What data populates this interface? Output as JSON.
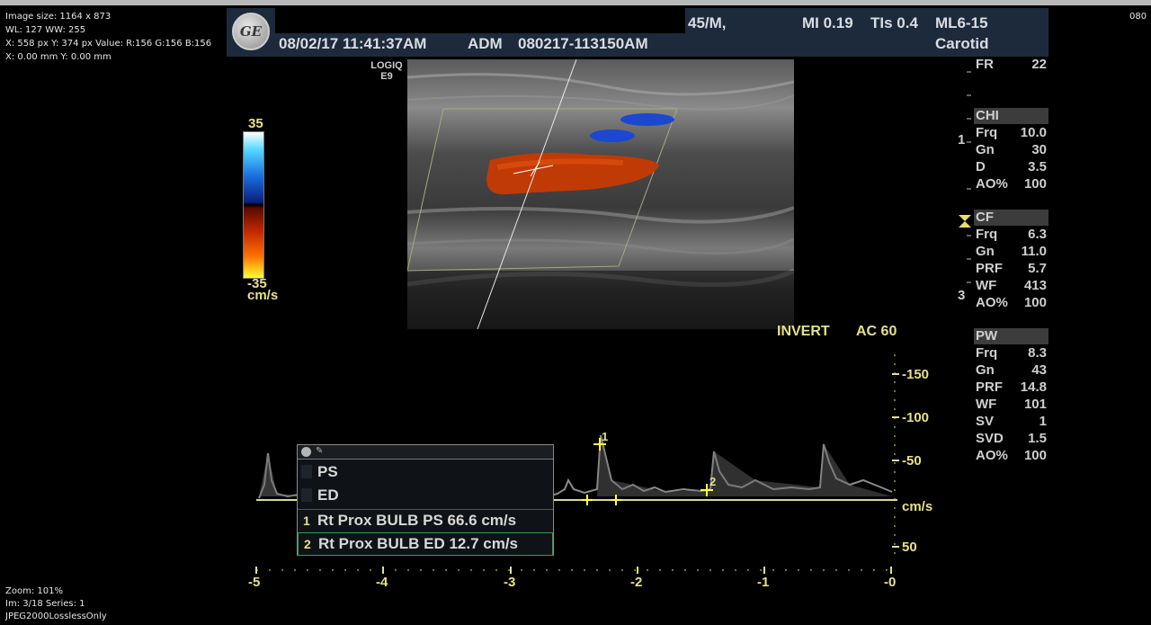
{
  "viewer": {
    "image_size": "Image size: 1164 x 873",
    "window": "WL: 127 WW: 255",
    "cursor": "X: 558 px Y: 374 px Value: R:156 G:156 B:156",
    "mm": "X: 0.00 mm Y: 0.00 mm",
    "zoom": "Zoom: 101%",
    "series": "Im: 3/18  Series: 1",
    "compression": "JPEG2000LosslessOnly",
    "right_corner": "080"
  },
  "header": {
    "datetime": "08/02/17 11:41:37AM",
    "operator": "ADM",
    "exam_id": "080217-113150AM",
    "patient": "45/M,",
    "mi": "MI 0.19",
    "tis": "TIs 0.4",
    "probe": "ML6-15",
    "preset": "Carotid"
  },
  "device": {
    "line1": "LOGIQ",
    "line2": "E9"
  },
  "color_bar": {
    "max": "35",
    "min": "-35",
    "unit": "cm/s"
  },
  "params": {
    "fr": {
      "k": "FR",
      "v": "22"
    },
    "chi": {
      "title": "CHI",
      "rows": [
        {
          "k": "Frq",
          "v": "10.0"
        },
        {
          "k": "Gn",
          "v": "30"
        },
        {
          "k": "D",
          "v": "3.5"
        },
        {
          "k": "AO%",
          "v": "100"
        }
      ]
    },
    "cf": {
      "title": "CF",
      "rows": [
        {
          "k": "Frq",
          "v": "6.3"
        },
        {
          "k": "Gn",
          "v": "11.0"
        },
        {
          "k": "PRF",
          "v": "5.7"
        },
        {
          "k": "WF",
          "v": "413"
        },
        {
          "k": "AO%",
          "v": "100"
        }
      ]
    },
    "pw": {
      "title": "PW",
      "rows": [
        {
          "k": "Frq",
          "v": "8.3"
        },
        {
          "k": "Gn",
          "v": "43"
        },
        {
          "k": "PRF",
          "v": "14.8"
        },
        {
          "k": "WF",
          "v": "101"
        },
        {
          "k": "SV",
          "v": "1"
        },
        {
          "k": "SVD",
          "v": "1.5"
        },
        {
          "k": "AO%",
          "v": "100"
        }
      ]
    }
  },
  "depth_marks": {
    "d1": "1",
    "d3": "3"
  },
  "doppler": {
    "invert": "INVERT",
    "ac": "AC 60",
    "y_ticks": [
      "-150",
      "-100",
      "-50",
      "cm/s",
      "50"
    ],
    "x_ticks": [
      "-5",
      "-4",
      "-3",
      "-2",
      "-1",
      "-0"
    ],
    "marker1": "1",
    "marker2": "2"
  },
  "measurements": {
    "items": [
      {
        "label": "PS"
      },
      {
        "label": "ED"
      }
    ],
    "results": [
      {
        "num": "1",
        "text": "Rt Prox  BULB PS  66.6 cm/s"
      },
      {
        "num": "2",
        "text": "Rt Prox  BULB ED  12.7 cm/s"
      }
    ]
  }
}
